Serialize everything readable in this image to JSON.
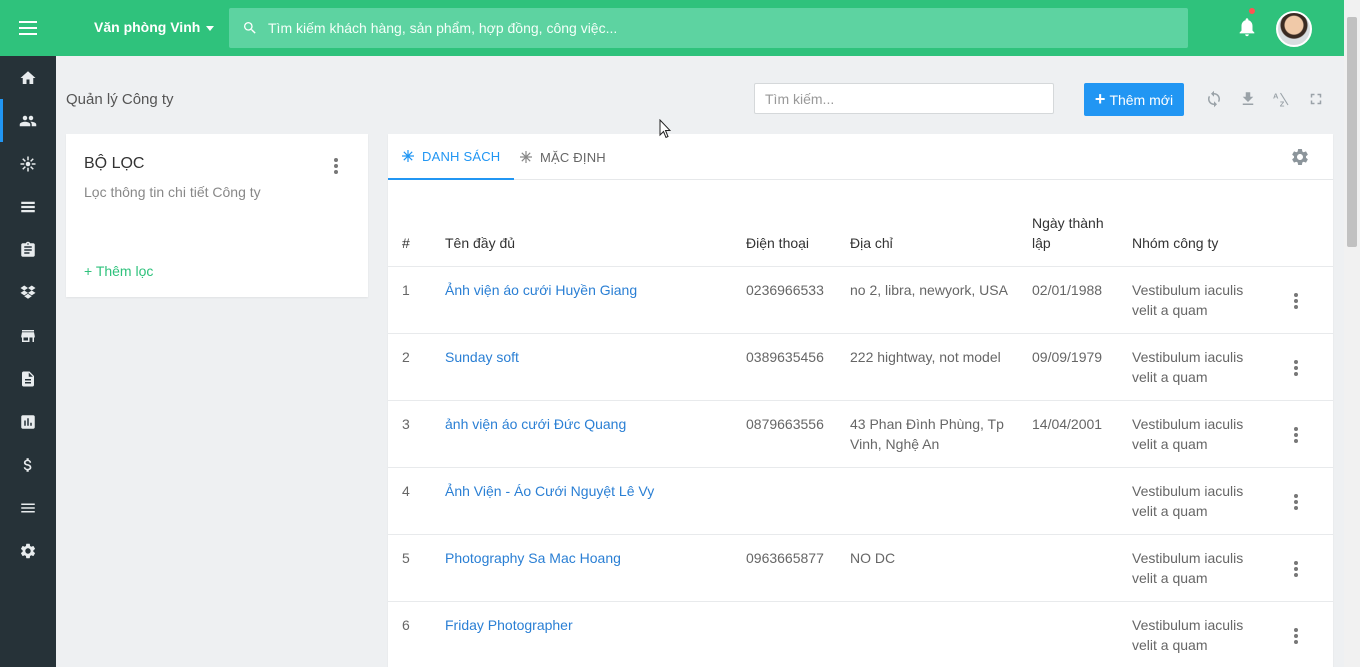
{
  "topbar": {
    "office_label": "Văn phòng Vinh",
    "search_placeholder": "Tìm kiếm khách hàng, sản phẩm, hợp đồng, công việc..."
  },
  "sidebar": {
    "items": [
      {
        "icon": "home-icon"
      },
      {
        "icon": "users-icon",
        "active": true
      },
      {
        "icon": "network-icon"
      },
      {
        "icon": "list-icon"
      },
      {
        "icon": "clipboard-icon"
      },
      {
        "icon": "dropbox-icon"
      },
      {
        "icon": "store-icon"
      },
      {
        "icon": "document-icon"
      },
      {
        "icon": "chart-icon"
      },
      {
        "icon": "dollar-icon"
      },
      {
        "icon": "menu-lines-icon"
      },
      {
        "icon": "settings-icon"
      }
    ]
  },
  "page": {
    "title": "Quản lý Công ty",
    "search_placeholder": "Tìm kiếm...",
    "add_label": "Thêm mới"
  },
  "filter": {
    "title": "BỘ LỌC",
    "subtitle": "Lọc thông tin chi tiết Công ty",
    "add_label": "+ Thêm lọc"
  },
  "tabs": [
    {
      "label": "DANH SÁCH",
      "active": true
    },
    {
      "label": "MẶC ĐỊNH",
      "active": false
    }
  ],
  "table": {
    "headers": {
      "index": "#",
      "name": "Tên đầy đủ",
      "phone": "Điện thoại",
      "address": "Địa chỉ",
      "founded": "Ngày thành lập",
      "group": "Nhóm công ty"
    },
    "rows": [
      {
        "index": "1",
        "name": "Ảnh viện áo cưới Huyền Giang",
        "phone": "0236966533",
        "address": "no 2, libra, newyork, USA",
        "founded": "02/01/1988",
        "group": "Vestibulum iaculis velit a quam"
      },
      {
        "index": "2",
        "name": "Sunday soft",
        "phone": "0389635456",
        "address": "222 hightway, not model",
        "founded": "09/09/1979",
        "group": "Vestibulum iaculis velit a quam"
      },
      {
        "index": "3",
        "name": "ảnh viện áo cưới Đức Quang",
        "phone": "0879663556",
        "address": "43 Phan Đình Phùng, Tp Vinh, Nghệ An",
        "founded": "14/04/2001",
        "group": "Vestibulum iaculis velit a quam"
      },
      {
        "index": "4",
        "name": "Ảnh Viện - Áo Cưới Nguyệt Lê Vy",
        "phone": "",
        "address": "",
        "founded": "",
        "group": "Vestibulum iaculis velit a quam"
      },
      {
        "index": "5",
        "name": "Photography Sa Mac Hoang",
        "phone": "0963665877",
        "address": "NO DC",
        "founded": "",
        "group": "Vestibulum iaculis velit a quam"
      },
      {
        "index": "6",
        "name": "Friday Photographer",
        "phone": "",
        "address": "",
        "founded": "",
        "group": "Vestibulum iaculis velit a quam"
      }
    ]
  },
  "colors": {
    "brand_green": "#2fc27c",
    "sidebar_dark": "#263238",
    "primary_blue": "#2196f3",
    "link_blue": "#2a7fd4"
  }
}
